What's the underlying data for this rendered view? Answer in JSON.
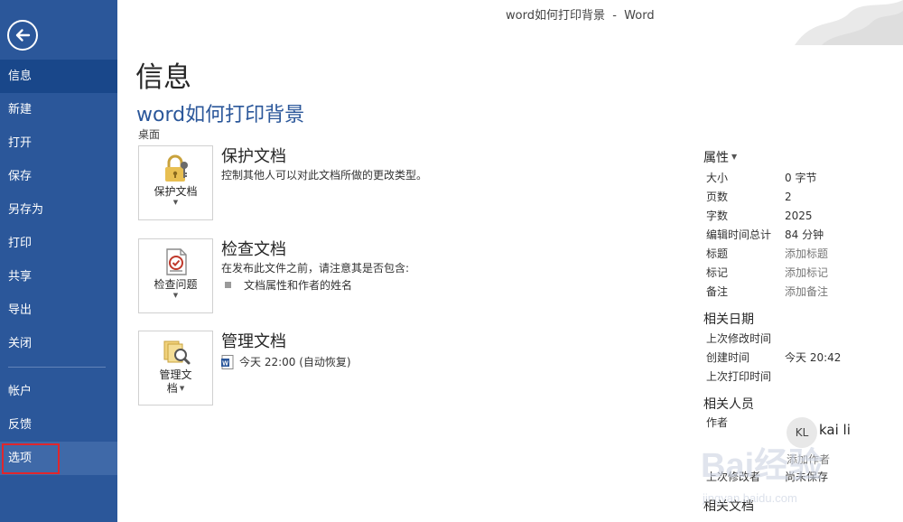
{
  "window": {
    "title": "word如何打印背景  -  Word"
  },
  "sidebar": {
    "items": [
      {
        "label": "信息",
        "name": "sidebar-item-info"
      },
      {
        "label": "新建",
        "name": "sidebar-item-new"
      },
      {
        "label": "打开",
        "name": "sidebar-item-open"
      },
      {
        "label": "保存",
        "name": "sidebar-item-save"
      },
      {
        "label": "另存为",
        "name": "sidebar-item-save-as"
      },
      {
        "label": "打印",
        "name": "sidebar-item-print"
      },
      {
        "label": "共享",
        "name": "sidebar-item-share"
      },
      {
        "label": "导出",
        "name": "sidebar-item-export"
      },
      {
        "label": "关闭",
        "name": "sidebar-item-close"
      }
    ],
    "bottom_items": [
      {
        "label": "帐户",
        "name": "sidebar-item-account"
      },
      {
        "label": "反馈",
        "name": "sidebar-item-feedback"
      },
      {
        "label": "选项",
        "name": "sidebar-item-options"
      }
    ],
    "active_item": "信息",
    "highlight_color": "#e0262c",
    "bg_color": "#2b579a"
  },
  "main": {
    "page_title": "信息",
    "doc_title": "word如何打印背景",
    "doc_location": "桌面",
    "sections": {
      "protect": {
        "button_label": "保护文档",
        "heading": "保护文档",
        "description": "控制其他人可以对此文档所做的更改类型。",
        "icon": "lock-key-icon"
      },
      "inspect": {
        "button_label": "检查问题",
        "heading": "检查文档",
        "description": "在发布此文件之前，请注意其是否包含:",
        "bullet": "文档属性和作者的姓名",
        "icon": "inspect-document-icon"
      },
      "manage": {
        "button_label_line1": "管理文",
        "button_label_line2": "档",
        "heading": "管理文档",
        "version": "今天 22:00 (自动恢复)",
        "icon": "manage-documents-icon"
      }
    }
  },
  "properties": {
    "heading": "属性",
    "rows": [
      {
        "label": "大小",
        "value": "0 字节"
      },
      {
        "label": "页数",
        "value": "2"
      },
      {
        "label": "字数",
        "value": "2025"
      },
      {
        "label": "编辑时间总计",
        "value": "84 分钟"
      },
      {
        "label": "标题",
        "value": "添加标题"
      },
      {
        "label": "标记",
        "value": "添加标记"
      },
      {
        "label": "备注",
        "value": "添加备注"
      }
    ]
  },
  "related_dates": {
    "heading": "相关日期",
    "rows": [
      {
        "label": "上次修改时间",
        "value": ""
      },
      {
        "label": "创建时间",
        "value": "今天 20:42"
      },
      {
        "label": "上次打印时间",
        "value": ""
      }
    ]
  },
  "related_people": {
    "heading": "相关人员",
    "author_label": "作者",
    "author_initials": "KL",
    "author_name": "kai li",
    "add_author": "添加作者",
    "last_modified_by_label": "上次修改者",
    "last_modified_by_value": "尚未保存"
  },
  "related_docs": {
    "heading": "相关文档"
  },
  "watermark": {
    "text": "Bai经验",
    "url": "jingyan.baidu.com"
  }
}
